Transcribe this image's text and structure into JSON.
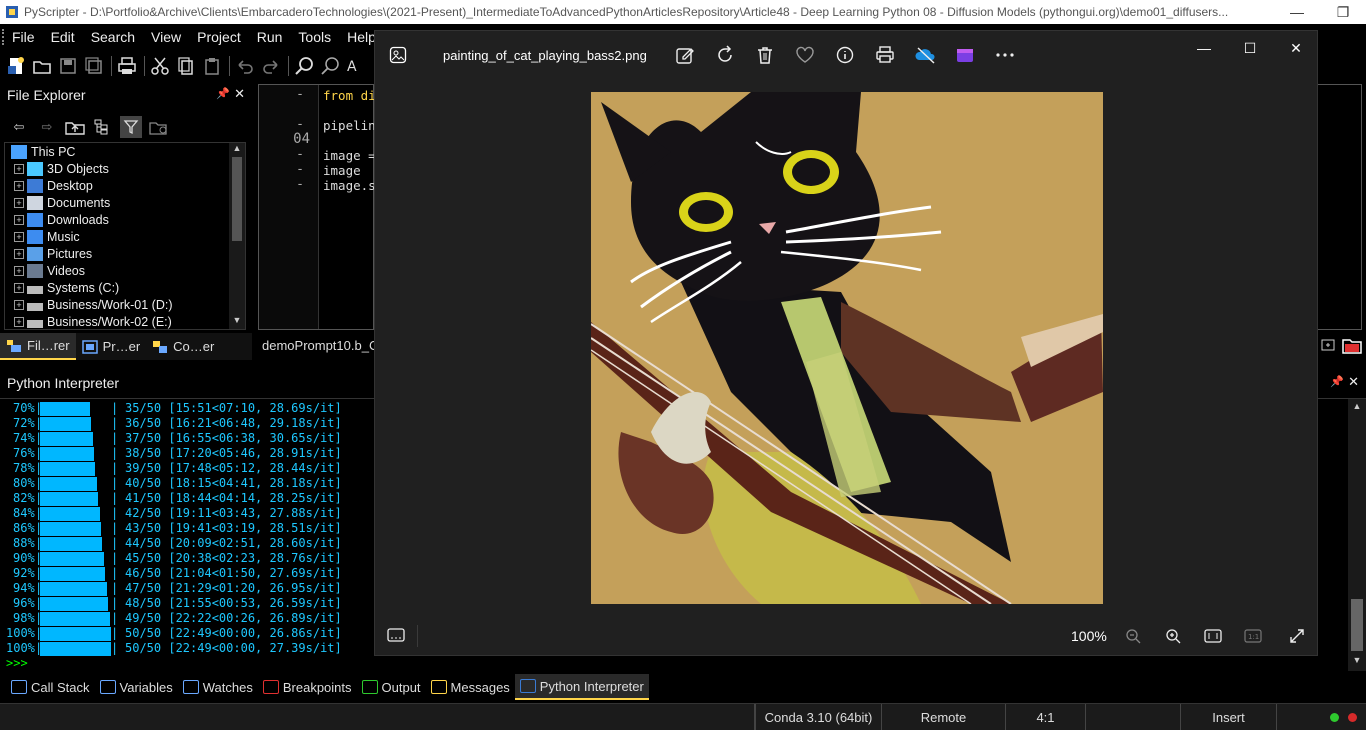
{
  "window": {
    "title": "PyScripter - D:\\Portfolio&Archive\\Clients\\EmbarcaderoTechnologies\\(2021-Present)_IntermediateToAdvancedPythonArticlesRepository\\Article48 - Deep Learning Python 08 - Diffusion Models (pythongui.org)\\demo01_diffusers..."
  },
  "menu": [
    "File",
    "Edit",
    "Search",
    "View",
    "Project",
    "Run",
    "Tools",
    "Help"
  ],
  "file_explorer": {
    "title": "File Explorer",
    "tree": [
      {
        "label": "This PC",
        "icon": "pc-icon",
        "root": true
      },
      {
        "label": "3D Objects",
        "icon": "3d-objects-icon"
      },
      {
        "label": "Desktop",
        "icon": "desktop-icon"
      },
      {
        "label": "Documents",
        "icon": "documents-icon"
      },
      {
        "label": "Downloads",
        "icon": "downloads-icon"
      },
      {
        "label": "Music",
        "icon": "music-icon"
      },
      {
        "label": "Pictures",
        "icon": "pictures-icon"
      },
      {
        "label": "Videos",
        "icon": "videos-icon"
      },
      {
        "label": "Systems (C:)",
        "icon": "drive-icon"
      },
      {
        "label": "Business/Work-01 (D:)",
        "icon": "drive-icon"
      },
      {
        "label": "Business/Work-02 (E:)",
        "icon": "drive-icon"
      }
    ],
    "tabs": [
      "Fil…rer",
      "Pr…er",
      "Co…er"
    ]
  },
  "editor": {
    "gutter": [
      "-",
      "-",
      "04",
      "-",
      "-",
      "-"
    ],
    "code": [
      "from di",
      "pipelin",
      "image =",
      "image",
      "image.sa"
    ],
    "tab": "demoPrompt10.b_C"
  },
  "interpreter": {
    "title": "Python Interpreter",
    "lines": [
      {
        "pct": "70%",
        "progress": 0.7,
        "text": "35/50 [15:51<07:10, 28.69s/it]"
      },
      {
        "pct": "72%",
        "progress": 0.72,
        "text": "36/50 [16:21<06:48, 29.18s/it]"
      },
      {
        "pct": "74%",
        "progress": 0.74,
        "text": "37/50 [16:55<06:38, 30.65s/it]"
      },
      {
        "pct": "76%",
        "progress": 0.76,
        "text": "38/50 [17:20<05:46, 28.91s/it]"
      },
      {
        "pct": "78%",
        "progress": 0.78,
        "text": "39/50 [17:48<05:12, 28.44s/it]"
      },
      {
        "pct": "80%",
        "progress": 0.8,
        "text": "40/50 [18:15<04:41, 28.18s/it]"
      },
      {
        "pct": "82%",
        "progress": 0.82,
        "text": "41/50 [18:44<04:14, 28.25s/it]"
      },
      {
        "pct": "84%",
        "progress": 0.84,
        "text": "42/50 [19:11<03:43, 27.88s/it]"
      },
      {
        "pct": "86%",
        "progress": 0.86,
        "text": "43/50 [19:41<03:19, 28.51s/it]"
      },
      {
        "pct": "88%",
        "progress": 0.88,
        "text": "44/50 [20:09<02:51, 28.60s/it]"
      },
      {
        "pct": "90%",
        "progress": 0.9,
        "text": "45/50 [20:38<02:23, 28.76s/it]"
      },
      {
        "pct": "92%",
        "progress": 0.92,
        "text": "46/50 [21:04<01:50, 27.69s/it]"
      },
      {
        "pct": "94%",
        "progress": 0.94,
        "text": "47/50 [21:29<01:20, 26.95s/it]"
      },
      {
        "pct": "96%",
        "progress": 0.96,
        "text": "48/50 [21:55<00:53, 26.59s/it]"
      },
      {
        "pct": "98%",
        "progress": 0.98,
        "text": "49/50 [22:22<00:26, 26.89s/it]"
      },
      {
        "pct": "100%",
        "progress": 1.0,
        "text": "50/50 [22:49<00:00, 26.86s/it]"
      },
      {
        "pct": "100%",
        "progress": 1.0,
        "text": "50/50 [22:49<00:00, 27.39s/it]"
      }
    ],
    "prompt": ">>>"
  },
  "bottom_tabs": [
    {
      "label": "Call Stack",
      "icon": "call-stack-icon"
    },
    {
      "label": "Variables",
      "icon": "variables-icon"
    },
    {
      "label": "Watches",
      "icon": "watches-icon"
    },
    {
      "label": "Breakpoints",
      "icon": "breakpoints-icon"
    },
    {
      "label": "Output",
      "icon": "output-icon"
    },
    {
      "label": "Messages",
      "icon": "messages-icon"
    },
    {
      "label": "Python Interpreter",
      "icon": "python-icon",
      "active": true
    }
  ],
  "status": {
    "env": "Conda 3.10 (64bit)",
    "mode": "Remote",
    "position": "4:1",
    "insert": "Insert"
  },
  "viewer": {
    "filename": "painting_of_cat_playing_bass2.png",
    "actions": [
      "edit-icon",
      "rotate-icon",
      "delete-icon",
      "favorite-icon",
      "info-icon",
      "print-icon",
      "onedrive-icon",
      "clipchamp-icon",
      "more-icon"
    ],
    "zoom": "100%"
  },
  "colors": {
    "progress": "#00b7ff",
    "terminal_text": "#1ec8ff",
    "accent": "#ffd54a"
  }
}
